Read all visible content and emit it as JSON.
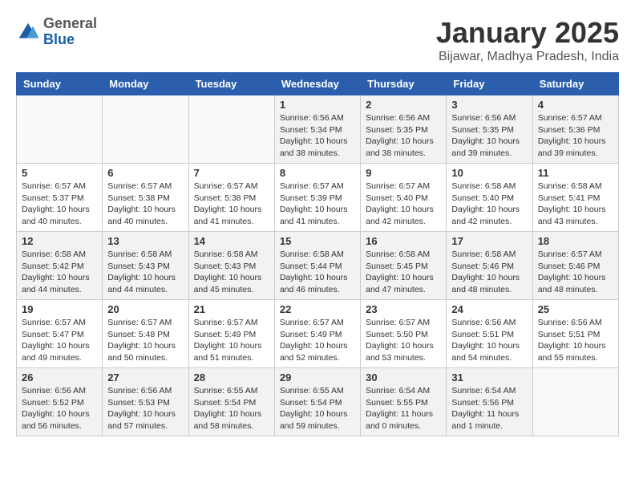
{
  "header": {
    "logo": {
      "general": "General",
      "blue": "Blue"
    },
    "title": "January 2025",
    "location": "Bijawar, Madhya Pradesh, India"
  },
  "weekdays": [
    "Sunday",
    "Monday",
    "Tuesday",
    "Wednesday",
    "Thursday",
    "Friday",
    "Saturday"
  ],
  "weeks": [
    [
      {
        "day": "",
        "info": ""
      },
      {
        "day": "",
        "info": ""
      },
      {
        "day": "",
        "info": ""
      },
      {
        "day": "1",
        "info": "Sunrise: 6:56 AM\nSunset: 5:34 PM\nDaylight: 10 hours\nand 38 minutes."
      },
      {
        "day": "2",
        "info": "Sunrise: 6:56 AM\nSunset: 5:35 PM\nDaylight: 10 hours\nand 38 minutes."
      },
      {
        "day": "3",
        "info": "Sunrise: 6:56 AM\nSunset: 5:35 PM\nDaylight: 10 hours\nand 39 minutes."
      },
      {
        "day": "4",
        "info": "Sunrise: 6:57 AM\nSunset: 5:36 PM\nDaylight: 10 hours\nand 39 minutes."
      }
    ],
    [
      {
        "day": "5",
        "info": "Sunrise: 6:57 AM\nSunset: 5:37 PM\nDaylight: 10 hours\nand 40 minutes."
      },
      {
        "day": "6",
        "info": "Sunrise: 6:57 AM\nSunset: 5:38 PM\nDaylight: 10 hours\nand 40 minutes."
      },
      {
        "day": "7",
        "info": "Sunrise: 6:57 AM\nSunset: 5:38 PM\nDaylight: 10 hours\nand 41 minutes."
      },
      {
        "day": "8",
        "info": "Sunrise: 6:57 AM\nSunset: 5:39 PM\nDaylight: 10 hours\nand 41 minutes."
      },
      {
        "day": "9",
        "info": "Sunrise: 6:57 AM\nSunset: 5:40 PM\nDaylight: 10 hours\nand 42 minutes."
      },
      {
        "day": "10",
        "info": "Sunrise: 6:58 AM\nSunset: 5:40 PM\nDaylight: 10 hours\nand 42 minutes."
      },
      {
        "day": "11",
        "info": "Sunrise: 6:58 AM\nSunset: 5:41 PM\nDaylight: 10 hours\nand 43 minutes."
      }
    ],
    [
      {
        "day": "12",
        "info": "Sunrise: 6:58 AM\nSunset: 5:42 PM\nDaylight: 10 hours\nand 44 minutes."
      },
      {
        "day": "13",
        "info": "Sunrise: 6:58 AM\nSunset: 5:43 PM\nDaylight: 10 hours\nand 44 minutes."
      },
      {
        "day": "14",
        "info": "Sunrise: 6:58 AM\nSunset: 5:43 PM\nDaylight: 10 hours\nand 45 minutes."
      },
      {
        "day": "15",
        "info": "Sunrise: 6:58 AM\nSunset: 5:44 PM\nDaylight: 10 hours\nand 46 minutes."
      },
      {
        "day": "16",
        "info": "Sunrise: 6:58 AM\nSunset: 5:45 PM\nDaylight: 10 hours\nand 47 minutes."
      },
      {
        "day": "17",
        "info": "Sunrise: 6:58 AM\nSunset: 5:46 PM\nDaylight: 10 hours\nand 48 minutes."
      },
      {
        "day": "18",
        "info": "Sunrise: 6:57 AM\nSunset: 5:46 PM\nDaylight: 10 hours\nand 48 minutes."
      }
    ],
    [
      {
        "day": "19",
        "info": "Sunrise: 6:57 AM\nSunset: 5:47 PM\nDaylight: 10 hours\nand 49 minutes."
      },
      {
        "day": "20",
        "info": "Sunrise: 6:57 AM\nSunset: 5:48 PM\nDaylight: 10 hours\nand 50 minutes."
      },
      {
        "day": "21",
        "info": "Sunrise: 6:57 AM\nSunset: 5:49 PM\nDaylight: 10 hours\nand 51 minutes."
      },
      {
        "day": "22",
        "info": "Sunrise: 6:57 AM\nSunset: 5:49 PM\nDaylight: 10 hours\nand 52 minutes."
      },
      {
        "day": "23",
        "info": "Sunrise: 6:57 AM\nSunset: 5:50 PM\nDaylight: 10 hours\nand 53 minutes."
      },
      {
        "day": "24",
        "info": "Sunrise: 6:56 AM\nSunset: 5:51 PM\nDaylight: 10 hours\nand 54 minutes."
      },
      {
        "day": "25",
        "info": "Sunrise: 6:56 AM\nSunset: 5:51 PM\nDaylight: 10 hours\nand 55 minutes."
      }
    ],
    [
      {
        "day": "26",
        "info": "Sunrise: 6:56 AM\nSunset: 5:52 PM\nDaylight: 10 hours\nand 56 minutes."
      },
      {
        "day": "27",
        "info": "Sunrise: 6:56 AM\nSunset: 5:53 PM\nDaylight: 10 hours\nand 57 minutes."
      },
      {
        "day": "28",
        "info": "Sunrise: 6:55 AM\nSunset: 5:54 PM\nDaylight: 10 hours\nand 58 minutes."
      },
      {
        "day": "29",
        "info": "Sunrise: 6:55 AM\nSunset: 5:54 PM\nDaylight: 10 hours\nand 59 minutes."
      },
      {
        "day": "30",
        "info": "Sunrise: 6:54 AM\nSunset: 5:55 PM\nDaylight: 11 hours\nand 0 minutes."
      },
      {
        "day": "31",
        "info": "Sunrise: 6:54 AM\nSunset: 5:56 PM\nDaylight: 11 hours\nand 1 minute."
      },
      {
        "day": "",
        "info": ""
      }
    ]
  ]
}
